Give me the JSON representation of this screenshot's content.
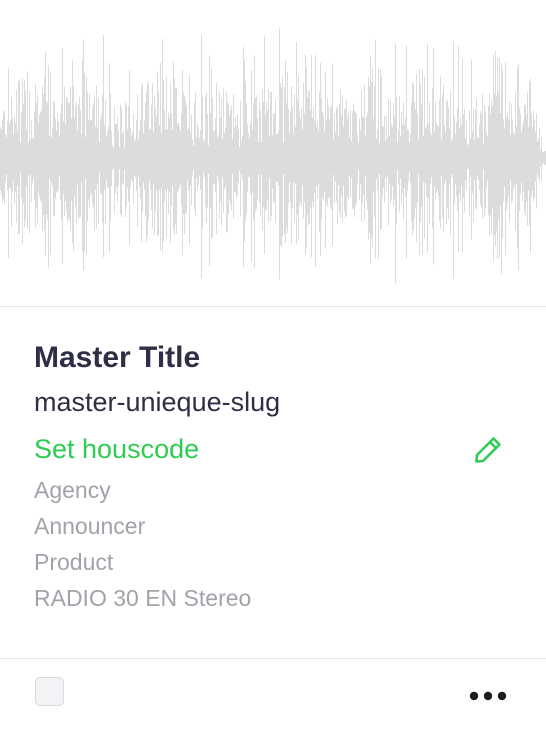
{
  "card": {
    "title": "Master Title",
    "slug": "master-unieque-slug",
    "housecode_link": "Set houscode",
    "meta": [
      "Agency",
      "Announcer",
      "Product",
      "RADIO 30 EN Stereo"
    ]
  },
  "icons": {
    "edit": "pencil-icon",
    "more": "more-horizontal-icon"
  },
  "colors": {
    "title": "#2e2e46",
    "accent_green": "#2ecc52",
    "muted_text": "#a2a2aa",
    "waveform": "#dcdcdc",
    "divider": "#e6e6ea"
  }
}
